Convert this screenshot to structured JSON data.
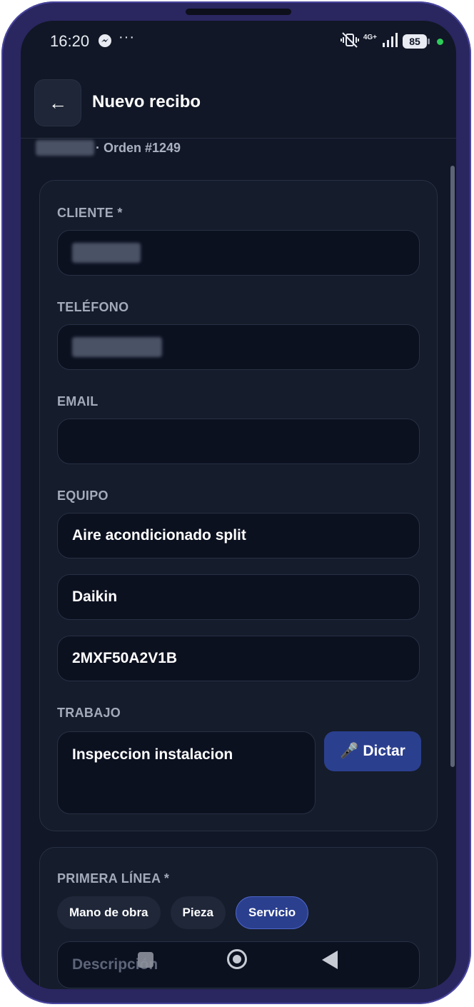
{
  "status_bar": {
    "time": "16:20",
    "more": "···",
    "network": "4G+",
    "battery": "85"
  },
  "header": {
    "back_icon": "←",
    "title": "Nuevo recibo",
    "subtitle": "· Orden #1249"
  },
  "form": {
    "cliente_label": "CLIENTE *",
    "telefono_label": "TELÉFONO",
    "email_label": "EMAIL",
    "email_value": "",
    "equipo_label": "EQUIPO",
    "equipo_tipo": "Aire acondicionado split",
    "equipo_marca": "Daikin",
    "equipo_modelo": "2MXF50A2V1B",
    "trabajo_label": "TRABAJO",
    "trabajo_value": "Inspeccion instalacion",
    "dictar_icon": "🎤",
    "dictar_label": "Dictar"
  },
  "lines": {
    "label": "PRIMERA LÍNEA *",
    "chips": [
      "Mano de obra",
      "Pieza",
      "Servicio"
    ],
    "selected_chip": "Servicio",
    "descripcion_placeholder": "Descripción"
  },
  "colors": {
    "background": "#111726",
    "card": "#151c2b",
    "input": "#0c1120",
    "accent": "#2b3f8f",
    "label": "#a3abbb"
  }
}
